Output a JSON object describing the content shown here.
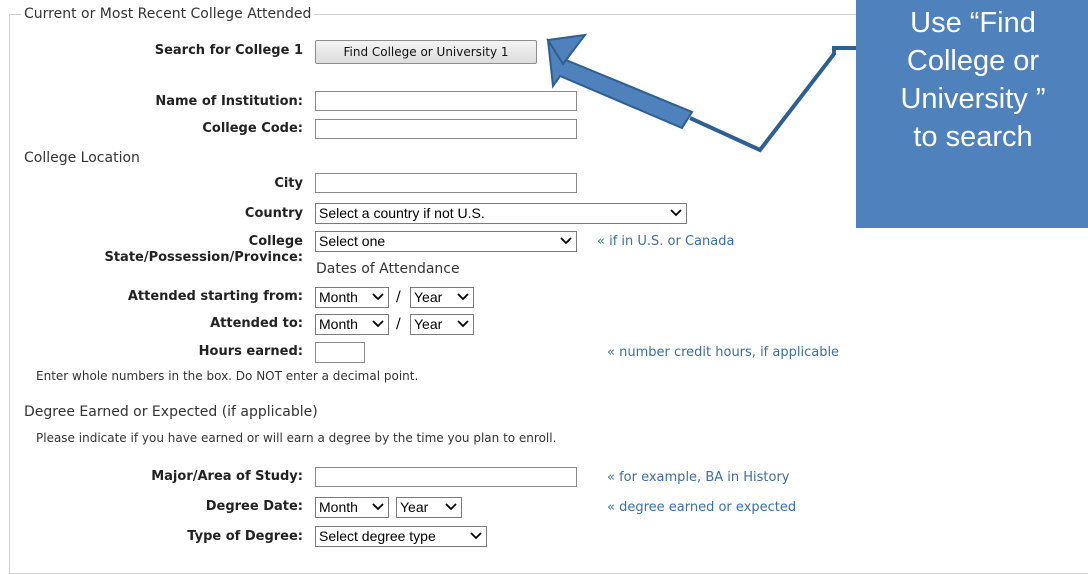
{
  "form": {
    "legend": "Current or Most Recent College Attended",
    "search_label": "Search for College 1",
    "find_button": "Find College or University 1",
    "name_label": "Name of Institution:",
    "code_label": "College Code:",
    "location_title": "College Location",
    "city_label": "City",
    "country_label": "Country",
    "country_value": "Select a country if not U.S.",
    "state_label_1": "College",
    "state_label_2": "State/Possession/Province:",
    "state_value": "Select one",
    "state_hint": "« if in U.S. or Canada",
    "dates_title": "Dates of Attendance",
    "from_label": "Attended starting from:",
    "to_label": "Attended to:",
    "month": "Month",
    "year": "Year",
    "slash": "/",
    "hours_label": "Hours earned:",
    "hours_hint": "« number credit hours, if applicable",
    "hours_note": "Enter whole numbers in the box. Do NOT enter a decimal point.",
    "degree_title": "Degree Earned or Expected (if applicable)",
    "degree_note": "Please indicate if you have earned or will earn a degree by the time you plan to enroll.",
    "major_label": "Major/Area of Study:",
    "major_hint": "« for example, BA in History",
    "degree_date_label": "Degree Date:",
    "degree_date_hint": "« degree earned or expected",
    "degree_type_label": "Type of Degree:",
    "degree_type_value": "Select degree type"
  },
  "callout": {
    "line1": "Use “Find",
    "line2": "College or",
    "line3": "University ”",
    "line4": "to search"
  },
  "colors": {
    "callout_bg": "#4f81bd",
    "hint": "#3b6ea5",
    "arrow": "#4f81bd"
  }
}
